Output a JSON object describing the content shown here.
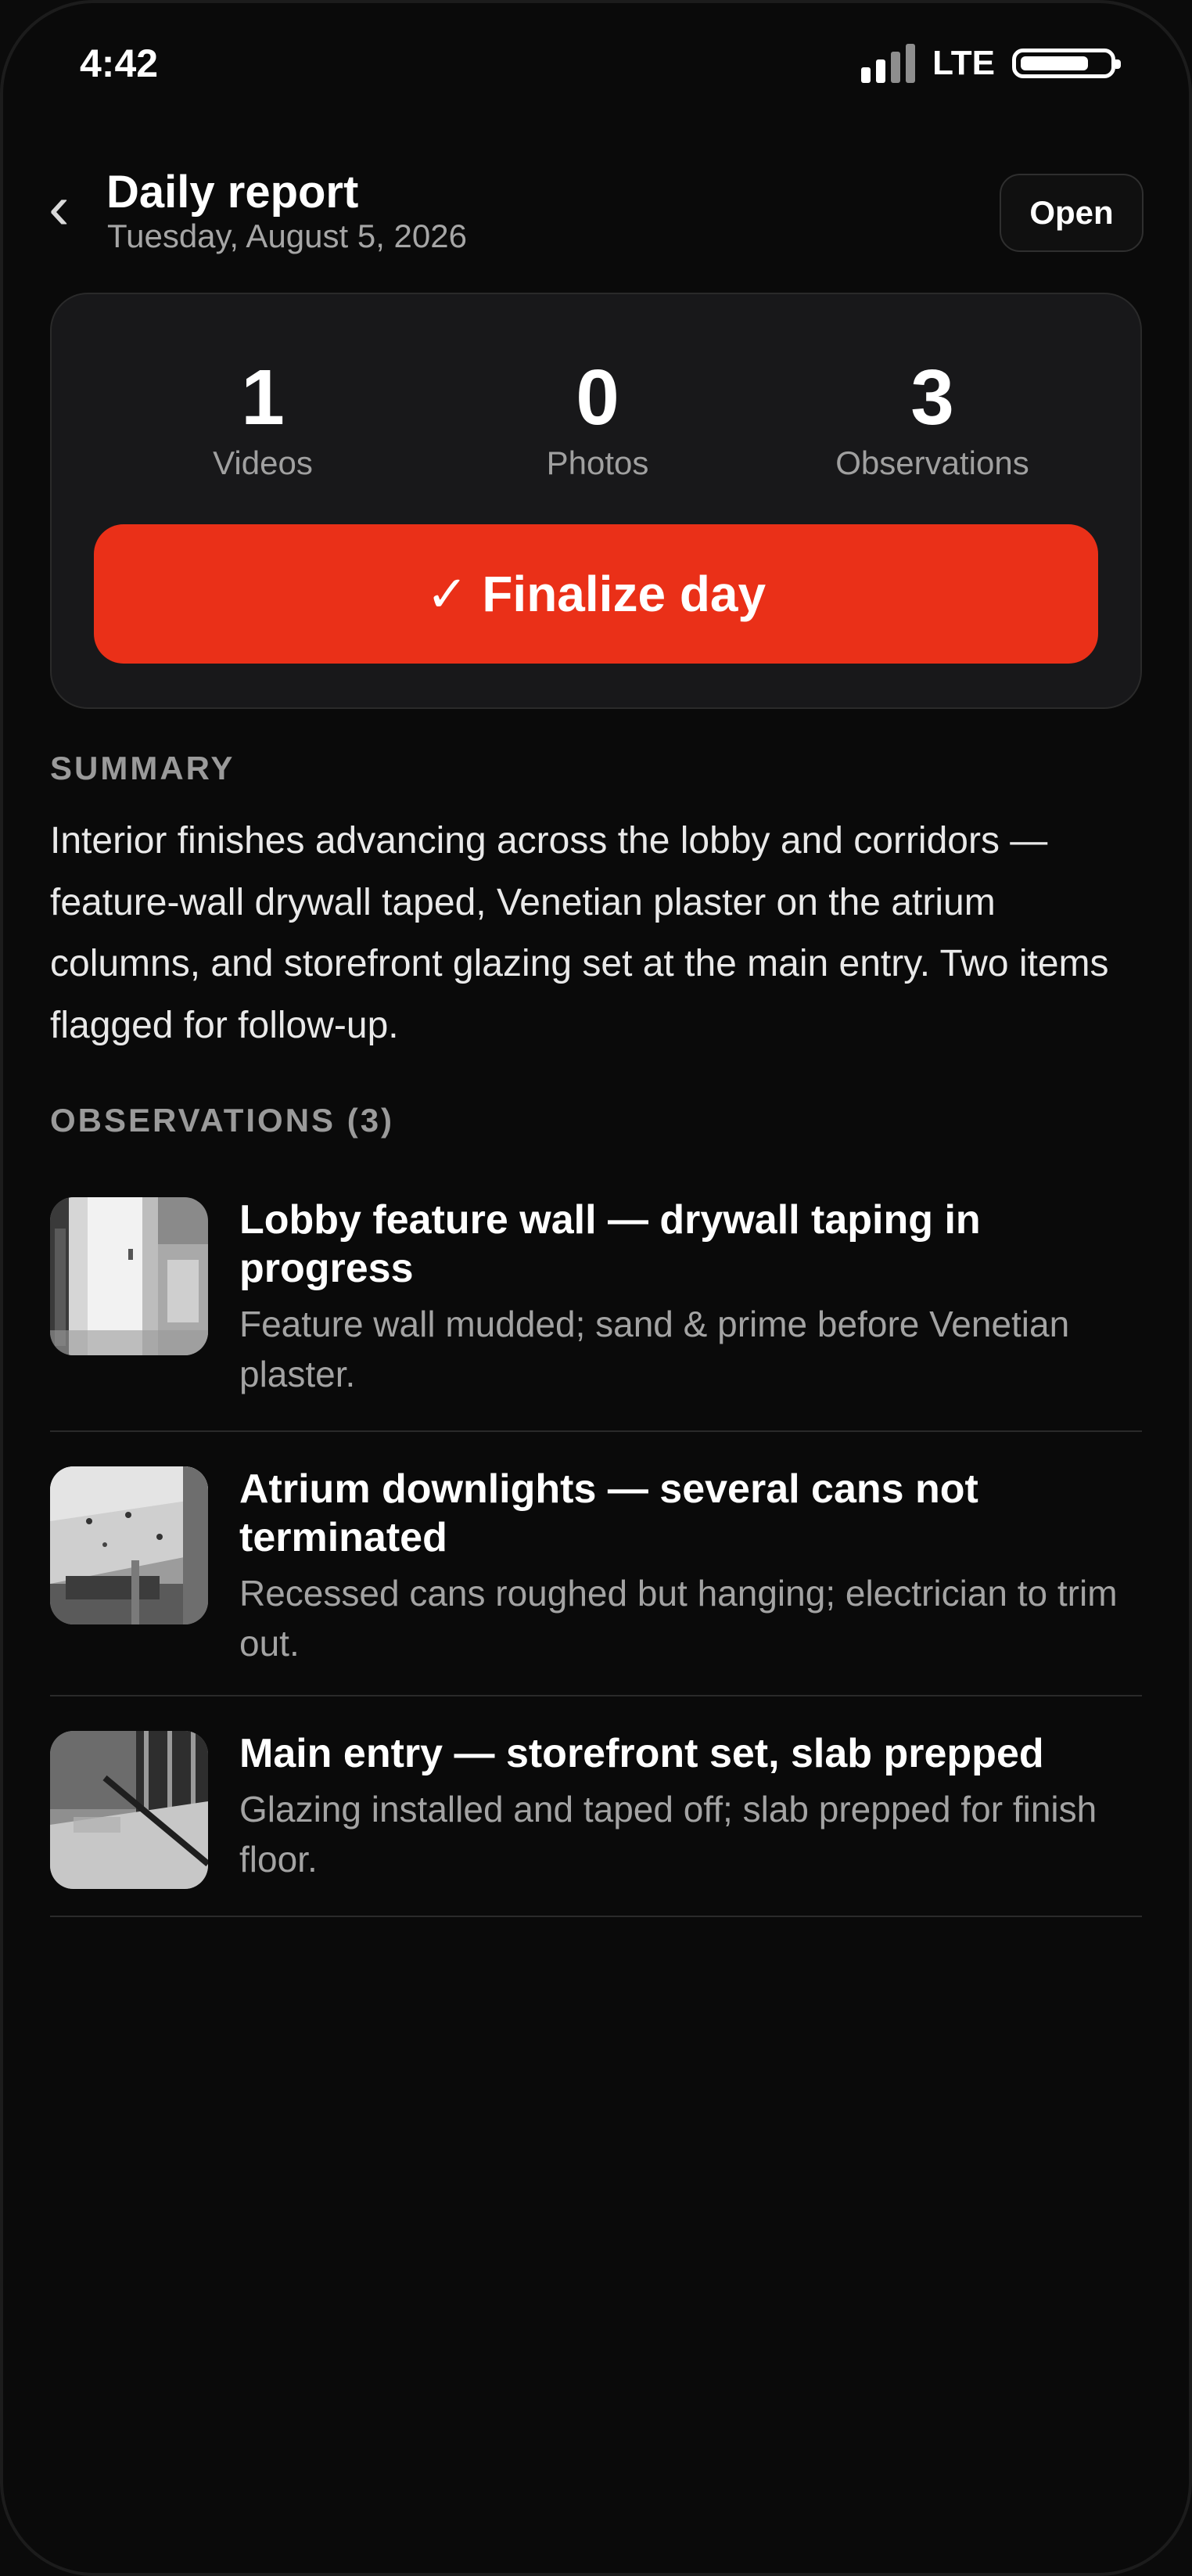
{
  "status_bar": {
    "time": "4:42",
    "network": "LTE",
    "battery_level": 0.78
  },
  "header": {
    "back_icon": "chevron-left-icon",
    "back_glyph": "‹",
    "title": "Daily report",
    "date": "Tuesday, August 5, 2026",
    "status_button": "Open"
  },
  "stats": [
    {
      "value": "1",
      "label": "Videos"
    },
    {
      "value": "0",
      "label": "Photos"
    },
    {
      "value": "3",
      "label": "Observations"
    }
  ],
  "finalize_button": {
    "label": "✓ Finalize day",
    "color": "#ea3018"
  },
  "summary": {
    "heading": "SUMMARY",
    "text": "Interior finishes advancing across the lobby and corridors — feature-wall drywall taped, Venetian plaster on the atrium columns, and storefront glazing set at the main entry. Two items flagged for follow-up."
  },
  "observations": {
    "heading": "OBSERVATIONS (3)",
    "items": [
      {
        "title": "Lobby feature wall — drywall taping in progress",
        "description": "Feature wall mudded; sand & prime before Venetian plaster."
      },
      {
        "title": "Atrium downlights — several cans not terminated",
        "description": "Recessed cans roughed but hanging; electrician to trim out."
      },
      {
        "title": "Main entry — storefront set, slab prepped",
        "description": "Glazing installed and taped off; slab prepped for finish floor."
      }
    ]
  }
}
